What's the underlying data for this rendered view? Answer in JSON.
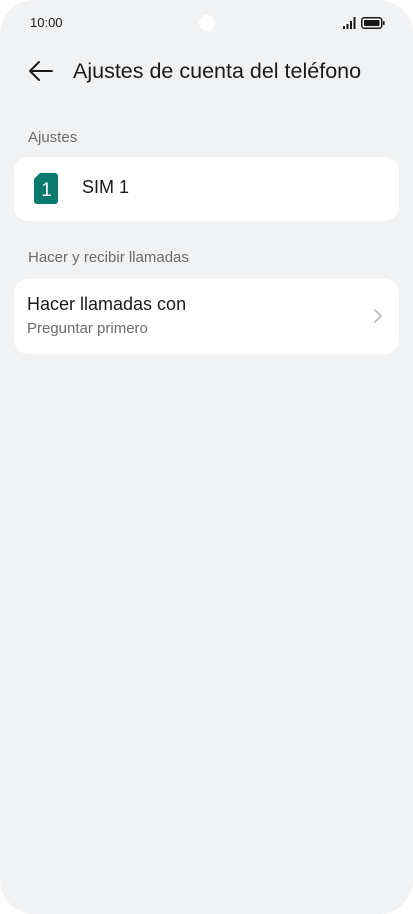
{
  "status_bar": {
    "time": "10:00"
  },
  "header": {
    "title": "Ajustes de cuenta del teléfono",
    "back_icon": "arrow-left-icon"
  },
  "sections": {
    "settings": {
      "label": "Ajustes",
      "sim": {
        "badge": "1",
        "label": "SIM 1",
        "color": "#0a7a6e"
      }
    },
    "calls": {
      "label": "Hacer y recibir llamadas",
      "item": {
        "title": "Hacer llamadas con",
        "subtitle": "Preguntar primero",
        "icon": "chevron-right-icon"
      }
    }
  }
}
